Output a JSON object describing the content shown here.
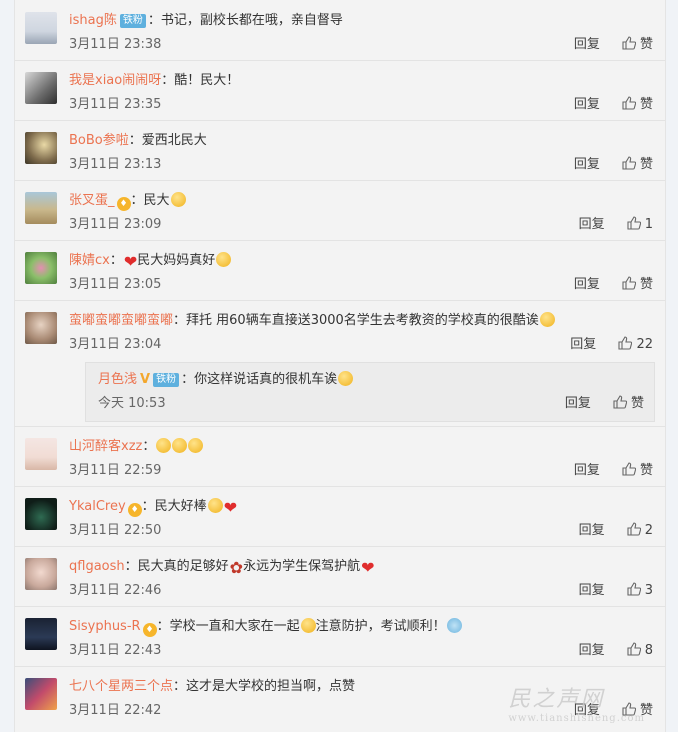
{
  "colors": {
    "username": "#eb7350",
    "badge": "#5eb0de",
    "heart": "#e02d2d"
  },
  "comments": [
    {
      "user": "ishag陈",
      "badge": "铁粉",
      "colon": "：",
      "text": "书记，副校长都在哦，亲自督导",
      "time": "3月11日 23:38",
      "reply": "回复",
      "like": "赞"
    },
    {
      "user": "我是xiao闹闹呀",
      "colon": "：",
      "text": "酷！民大！",
      "time": "3月11日 23:35",
      "reply": "回复",
      "like": "赞"
    },
    {
      "user": "BoBo参啦",
      "colon": "：",
      "text": "爱西北民大",
      "time": "3月11日 23:13",
      "reply": "回复",
      "like": "赞"
    },
    {
      "user": "张叉蛋_",
      "colon": "：",
      "text": "民大",
      "time": "3月11日 23:09",
      "reply": "回复",
      "like": "1"
    },
    {
      "user": "陳婧cx",
      "colon": "：",
      "text": "民大妈妈真好",
      "time": "3月11日 23:05",
      "reply": "回复",
      "like": "赞"
    },
    {
      "user": "蛮嘟蛮嘟蛮嘟蛮嘟",
      "colon": "：",
      "text": "拜托 用60辆车直接送3000名学生去考教资的学校真的很酷诶",
      "time": "3月11日 23:04",
      "reply": "回复",
      "like": "22"
    },
    {
      "user": "山河醉客xzz",
      "colon": "：",
      "text": "",
      "time": "3月11日 22:59",
      "reply": "回复",
      "like": "赞"
    },
    {
      "user": "YkalCrey",
      "colon": "：",
      "text": "民大好棒",
      "time": "3月11日 22:50",
      "reply": "回复",
      "like": "2"
    },
    {
      "user": "qflgaosh",
      "colon": "：",
      "text": "民大真的足够好",
      "text2": "永远为学生保驾护航",
      "time": "3月11日 22:46",
      "reply": "回复",
      "like": "3"
    },
    {
      "user": "Sisyphus-R",
      "colon": "：",
      "text": "学校一直和大家在一起",
      "text2": "注意防护，考试顺利！",
      "time": "3月11日 22:43",
      "reply": "回复",
      "like": "8"
    },
    {
      "user": "七八个星两三个点",
      "colon": "：",
      "text": "这才是大学校的担当啊，点赞",
      "time": "3月11日 22:42",
      "reply": "回复",
      "like": "赞"
    }
  ],
  "sub_reply": {
    "user": "月色浅",
    "badge": "铁粉",
    "colon": "：",
    "text": "你这样说话真的很机车诶",
    "time": "今天 10:53",
    "reply": "回复",
    "like": "赞"
  },
  "watermark": {
    "logo": "民之声网",
    "url": "www.tianshisheng.com"
  }
}
